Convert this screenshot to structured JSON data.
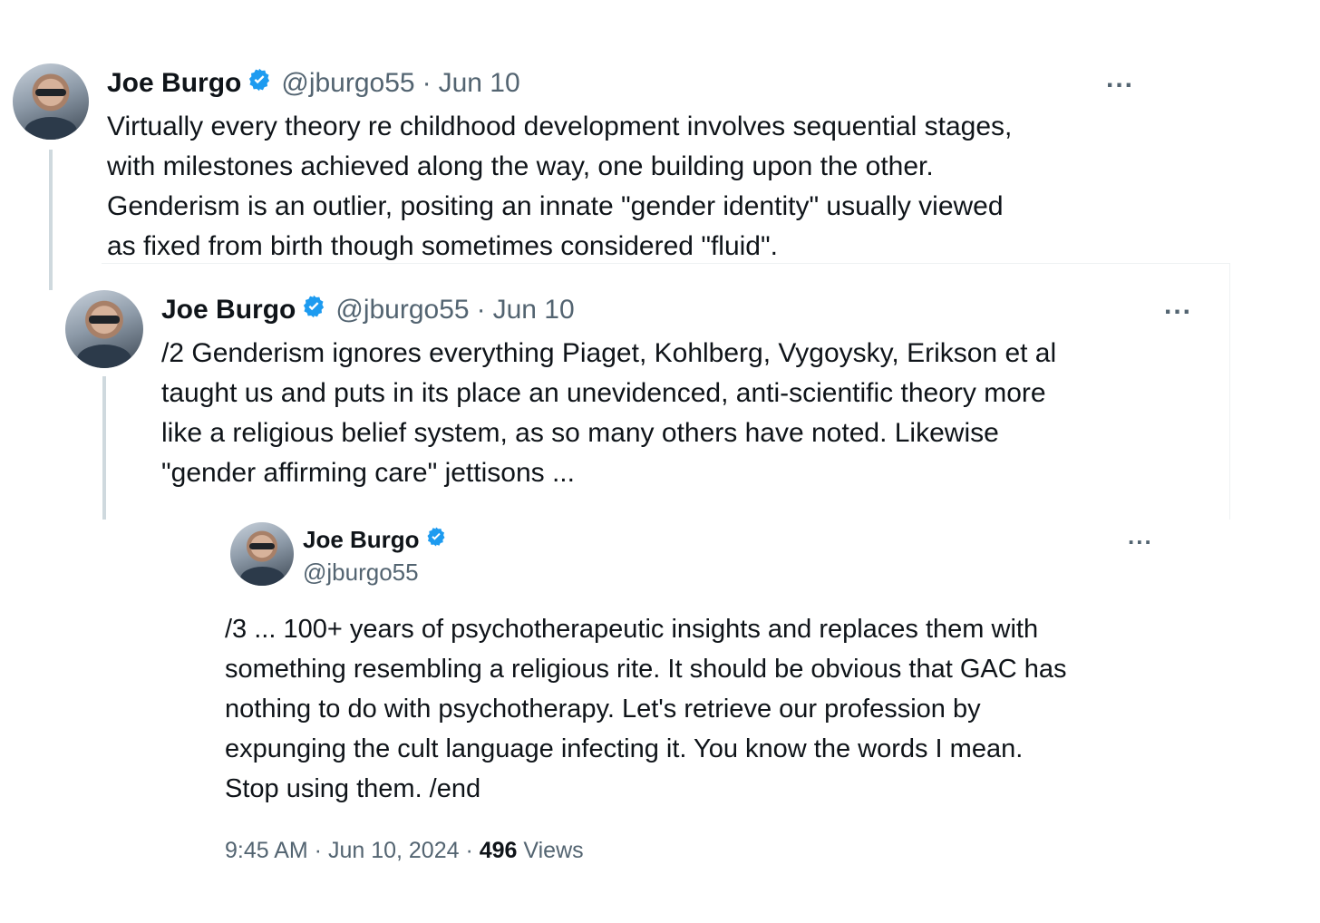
{
  "tweets": [
    {
      "name": "Joe Burgo",
      "handle": "@jburgo55",
      "date": "Jun 10",
      "text": "Virtually every theory re childhood development involves sequential stages,\nwith milestones achieved along the way, one building upon the other.\nGenderism is an outlier, positing an innate \"gender identity\" usually viewed\nas fixed from birth though sometimes considered \"fluid\".",
      "more": "..."
    },
    {
      "name": "Joe Burgo",
      "handle": "@jburgo55",
      "date": "Jun 10",
      "text": "/2 Genderism ignores everything Piaget, Kohlberg, Vygoysky, Erikson et al\ntaught us and puts in its place an unevidenced, anti-scientific theory more\nlike a religious belief system, as so many others have noted. Likewise\n\"gender affirming care\" jettisons ...",
      "more": "..."
    },
    {
      "name": "Joe Burgo",
      "handle": "@jburgo55",
      "text": "/3 ... 100+ years of psychotherapeutic insights and replaces them with\nsomething resembling a religious rite. It should be obvious that GAC has\nnothing to do with psychotherapy. Let's retrieve our profession by\nexpunging the cult language infecting it. You know the words I mean.\nStop using them. /end",
      "more": "...",
      "timestamp": "9:45 AM · Jun 10, 2024 · ",
      "views_count": "496",
      "views_label": " Views"
    }
  ],
  "colors": {
    "verified": "#1d9bf0",
    "secondary_text": "#536471",
    "primary_text": "#0f1419"
  },
  "icons": [
    "verified-badge-icon",
    "more-options-icon"
  ]
}
